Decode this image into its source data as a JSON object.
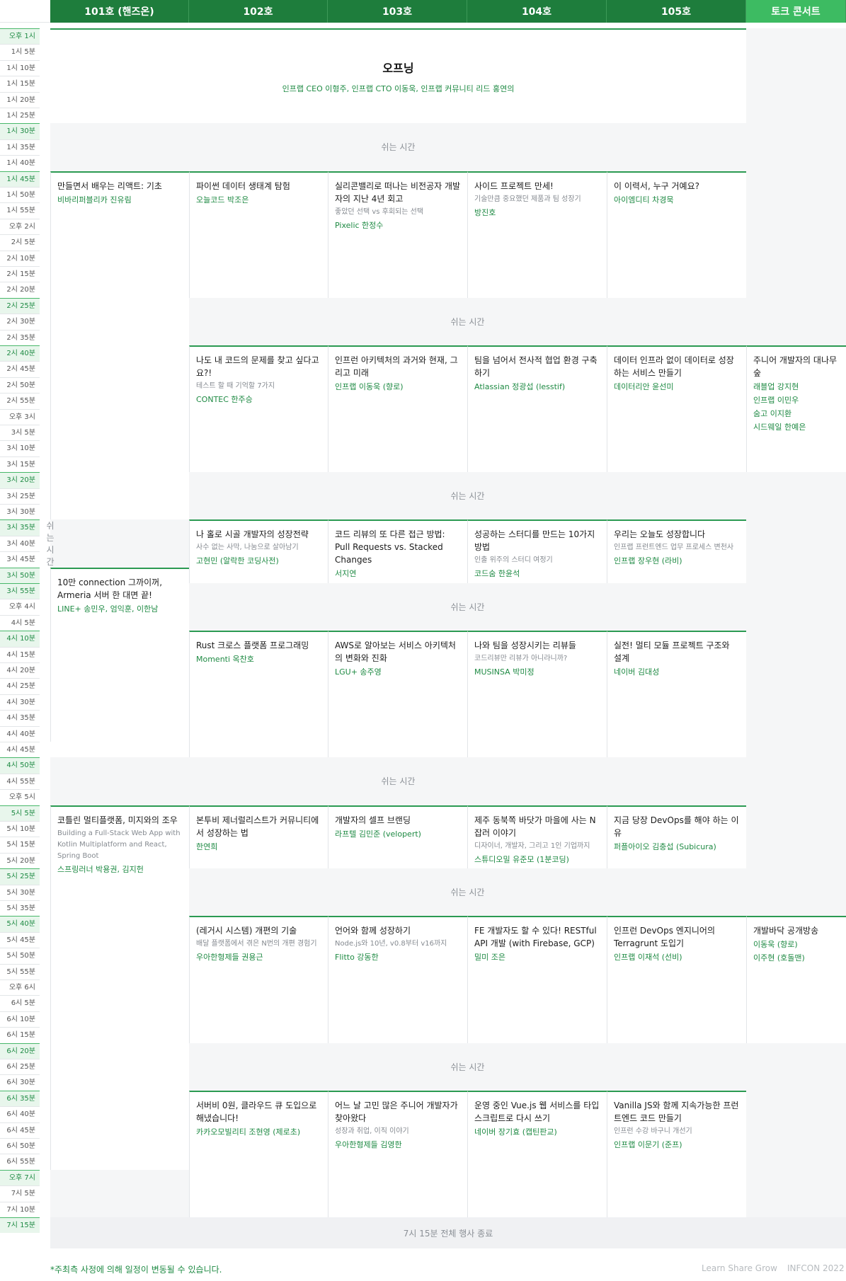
{
  "rooms": [
    "101호 (핸즈온)",
    "102호",
    "103호",
    "104호",
    "105호",
    "토크 콘서트"
  ],
  "times": [
    "오후 1시",
    "1시 5분",
    "1시 10분",
    "1시 15분",
    "1시 20분",
    "1시 25분",
    "1시 30분",
    "1시 35분",
    "1시 40분",
    "1시 45분",
    "1시 50분",
    "1시 55분",
    "오후 2시",
    "2시 5분",
    "2시 10분",
    "2시 15분",
    "2시 20분",
    "2시 25분",
    "2시 30분",
    "2시 35분",
    "2시 40분",
    "2시 45분",
    "2시 50분",
    "2시 55분",
    "오후 3시",
    "3시 5분",
    "3시 10분",
    "3시 15분",
    "3시 20분",
    "3시 25분",
    "3시 30분",
    "3시 35분",
    "3시 40분",
    "3시 45분",
    "3시 50분",
    "3시 55분",
    "오후 4시",
    "4시 5분",
    "4시 10분",
    "4시 15분",
    "4시 20분",
    "4시 25분",
    "4시 30분",
    "4시 35분",
    "4시 40분",
    "4시 45분",
    "4시 50분",
    "4시 55분",
    "오후 5시",
    "5시 5분",
    "5시 10분",
    "5시 15분",
    "5시 20분",
    "5시 25분",
    "5시 30분",
    "5시 35분",
    "5시 40분",
    "5시 45분",
    "5시 50분",
    "5시 55분",
    "오후 6시",
    "6시 5분",
    "6시 10분",
    "6시 15분",
    "6시 20분",
    "6시 25분",
    "6시 30분",
    "6시 35분",
    "6시 40분",
    "6시 45분",
    "6시 50분",
    "6시 55분",
    "오후 7시",
    "7시 5분",
    "7시 10분",
    "7시 15분"
  ],
  "highlighted_times": [
    0,
    6,
    9,
    17,
    20,
    28,
    31,
    34,
    35,
    38,
    46,
    49,
    53,
    56,
    64,
    67,
    72,
    75
  ],
  "opening": {
    "title": "오프닝",
    "speakers": "인프랩 CEO 이형주, 인프랩 CTO 이동욱, 인프랩 커뮤니티 리드 홍연의"
  },
  "break_label": "쉬는 시간",
  "end_label": "7시 15분 전체 행사 종료",
  "sessions": [
    {
      "id": "s1",
      "col": 0,
      "start": 9,
      "end": 31,
      "title": "만들면서 배우는 리액트: 기초",
      "subtitle": "",
      "speakers": [
        "비바리퍼블리카 진유림"
      ]
    },
    {
      "id": "s2",
      "col": 1,
      "start": 9,
      "end": 17,
      "title": "파이썬 데이터 생태계 탐험",
      "subtitle": "",
      "speakers": [
        "오늘코드 박조은"
      ]
    },
    {
      "id": "s3",
      "col": 2,
      "start": 9,
      "end": 17,
      "title": "실리콘밸리로 떠나는 비전공자 개발자의 지난 4년 회고",
      "subtitle": "좋았던 선택 vs 후회되는 선택",
      "speakers": [
        "Pixelic 한정수"
      ]
    },
    {
      "id": "s4",
      "col": 3,
      "start": 9,
      "end": 17,
      "title": "사이드 프로젝트 만세!",
      "subtitle": "기술만큼 중요했던 제품과 팀 성장기",
      "speakers": [
        "방진호"
      ]
    },
    {
      "id": "s5",
      "col": 4,
      "start": 9,
      "end": 17,
      "title": "이 이력서, 누구 거예요?",
      "subtitle": "",
      "speakers": [
        "아이엠디티 차경묵"
      ]
    },
    {
      "id": "s6",
      "col": 1,
      "start": 20,
      "end": 28,
      "title": "나도 내 코드의 문제를 찾고 싶다고요?!",
      "subtitle": "테스트 할 때 기억할 7가지",
      "speakers": [
        "CONTEC 한주승"
      ]
    },
    {
      "id": "s7",
      "col": 2,
      "start": 20,
      "end": 28,
      "title": "인프런 아키텍처의 과거와 현재, 그리고 미래",
      "subtitle": "",
      "speakers": [
        "인프랩 이동욱 (향로)"
      ]
    },
    {
      "id": "s8",
      "col": 3,
      "start": 20,
      "end": 28,
      "title": "팀을 넘어서 전사적 협업 환경 구축하기",
      "subtitle": "",
      "speakers": [
        "Atlassian 정광섭 (lesstif)"
      ]
    },
    {
      "id": "s9",
      "col": 4,
      "start": 20,
      "end": 28,
      "title": "데이터 인프라 없이 데이터로 성장하는 서비스 만들기",
      "subtitle": "",
      "speakers": [
        "데이터리안 윤선미"
      ]
    },
    {
      "id": "s10",
      "col": 5,
      "start": 20,
      "end": 28,
      "title": "주니어 개발자의 대나무숲",
      "subtitle": "",
      "speakers": [
        "래블업 강지현",
        "인프랩 이민우",
        "숨고 이지환",
        "시드웨일 한예은"
      ]
    },
    {
      "id": "s11",
      "col": 1,
      "start": 31,
      "end": 35,
      "title": "나 홀로 시골 개발자의 성장전략",
      "subtitle": "사수 없는 사막, 나눔으로 살아남기",
      "speakers": [
        "고현민 (알락한 코딩사전)"
      ]
    },
    {
      "id": "s12",
      "col": 2,
      "start": 31,
      "end": 35,
      "title": "코드 리뷰의 또 다른 접근 방법: Pull Requests vs. Stacked Changes",
      "subtitle": "",
      "speakers": [
        "서지연"
      ]
    },
    {
      "id": "s13",
      "col": 3,
      "start": 31,
      "end": 35,
      "title": "성공하는 스터디를 만드는 10가지 방법",
      "subtitle": "인출 위주의 스터디 여정기",
      "speakers": [
        "코드숨 한윤석"
      ]
    },
    {
      "id": "s14",
      "col": 4,
      "start": 31,
      "end": 35,
      "title": "우리는 오늘도 성장합니다",
      "subtitle": "인프랩 프런트엔드 업무 프로세스 변천사",
      "speakers": [
        "인프랩 장우현 (라비)"
      ]
    },
    {
      "id": "s15",
      "col": 0,
      "start": 34,
      "end": 45,
      "title": "10만 connection 그까이꺼, Armeria 서버 한 대면 끝!",
      "subtitle": "",
      "speakers": [
        "LINE+ 송민우, 엄익훈, 이한남"
      ]
    },
    {
      "id": "s16",
      "col": 1,
      "start": 38,
      "end": 46,
      "title": "Rust 크로스 플랫폼 프로그래밍",
      "subtitle": "",
      "speakers": [
        "Momenti 옥찬호"
      ]
    },
    {
      "id": "s17",
      "col": 2,
      "start": 38,
      "end": 46,
      "title": "AWS로 알아보는 서비스 아키텍처의 변화와 진화",
      "subtitle": "",
      "speakers": [
        "LGU+ 송주영"
      ]
    },
    {
      "id": "s18",
      "col": 3,
      "start": 38,
      "end": 46,
      "title": "나와 팀을 성장시키는 리뷰들",
      "subtitle": "코드리뷰만 리뷰가 아니라니까?",
      "speakers": [
        "MUSINSA 박미정"
      ]
    },
    {
      "id": "s19",
      "col": 4,
      "start": 38,
      "end": 46,
      "title": "실전! 멀티 모듈 프로젝트 구조와 설계",
      "subtitle": "",
      "speakers": [
        "네이버 김대성"
      ]
    },
    {
      "id": "s20",
      "col": 0,
      "start": 49,
      "end": 72,
      "title": "코틀린 멀티플랫폼, 미지와의 조우",
      "subtitle": "Building a Full-Stack Web App with Kotlin Multiplatform and React, Spring Boot",
      "speakers": [
        "스프링러너 박용권, 김지헌"
      ]
    },
    {
      "id": "s21",
      "col": 1,
      "start": 49,
      "end": 53,
      "title": "본투비 제너럴리스트가 커뮤니티에서 성장하는 법",
      "subtitle": "",
      "speakers": [
        "한연희"
      ]
    },
    {
      "id": "s22",
      "col": 2,
      "start": 49,
      "end": 53,
      "title": "개발자의 셀프 브랜딩",
      "subtitle": "",
      "speakers": [
        "라프텔 김민준 (velopert)"
      ]
    },
    {
      "id": "s23",
      "col": 3,
      "start": 49,
      "end": 53,
      "title": "제주 동북쪽 바닷가 마을에 사는 N잡러 이야기",
      "subtitle": "디자이너, 개발자, 그리고 1인 기업까지",
      "speakers": [
        "스튜디오밀 유준모 (1분코딩)"
      ]
    },
    {
      "id": "s24",
      "col": 4,
      "start": 49,
      "end": 53,
      "title": "지금 당장 DevOps를 해야 하는 이유",
      "subtitle": "",
      "speakers": [
        "퍼플아이오 김충섭 (Subicura)"
      ]
    },
    {
      "id": "s25",
      "col": 1,
      "start": 56,
      "end": 64,
      "title": "(레거시 시스템) 개편의 기술",
      "subtitle": "배달 플랫폼에서 겪은 N번의 개편 경험기",
      "speakers": [
        "우아한형제들 권용근"
      ]
    },
    {
      "id": "s26",
      "col": 2,
      "start": 56,
      "end": 64,
      "title": "언어와 함께 성장하기",
      "subtitle": "Node.js와 10년, v0.8부터 v16까지",
      "speakers": [
        "Flitto 강동한"
      ]
    },
    {
      "id": "s27",
      "col": 3,
      "start": 56,
      "end": 64,
      "title": "FE 개발자도 할 수 있다! RESTful API 개발 (with Firebase, GCP)",
      "subtitle": "",
      "speakers": [
        "밀미 조은"
      ]
    },
    {
      "id": "s28",
      "col": 4,
      "start": 56,
      "end": 64,
      "title": "인프런 DevOps 엔지니어의 Terragrunt 도입기",
      "subtitle": "",
      "speakers": [
        "인프랩 이재석 (선비)"
      ]
    },
    {
      "id": "s29",
      "col": 5,
      "start": 56,
      "end": 64,
      "title": "개발바닥 공개방송",
      "subtitle": "",
      "speakers": [
        "이동욱 (향로)",
        "이주현 (호돌맨)"
      ]
    },
    {
      "id": "s30",
      "col": 1,
      "start": 67,
      "end": 75,
      "title": "서버비 0원, 클라우드 큐 도입으로 해냈습니다!",
      "subtitle": "",
      "speakers": [
        "카카오모빌리티 조현영 (제로초)"
      ]
    },
    {
      "id": "s31",
      "col": 2,
      "start": 67,
      "end": 75,
      "title": "어느 날 고민 많은 주니어 개발자가 찾아왔다",
      "subtitle": "성장과 취업, 이직 이야기",
      "speakers": [
        "우아한형제들 김영한"
      ]
    },
    {
      "id": "s32",
      "col": 3,
      "start": 67,
      "end": 75,
      "title": "운영 중인 Vue.js 웹 서비스를 타입스크립트로 다시 쓰기",
      "subtitle": "",
      "speakers": [
        "네이버 장기효 (캡틴판교)"
      ]
    },
    {
      "id": "s33",
      "col": 4,
      "start": 67,
      "end": 75,
      "title": "Vanilla JS와 함께 지속가능한 프런트엔드 코드 만들기",
      "subtitle": "인프런 수강 바구니 개선기",
      "speakers": [
        "인프랩 이문기 (준프)"
      ]
    }
  ],
  "footer": {
    "note": "*주최측 사정에 의해 일정이 변동될 수 있습니다.",
    "tagline": "Learn Share Grow",
    "event": "INFCON 2022"
  },
  "colors": {
    "brand_green": "#1e7d3c",
    "accent_green": "#2b9a52",
    "talk_green": "#3dbb62",
    "break_bg": "#f5f6f7"
  }
}
